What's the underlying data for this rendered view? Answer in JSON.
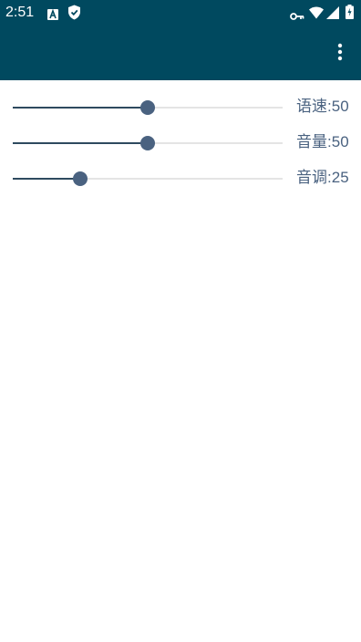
{
  "status_bar": {
    "time": "2:51",
    "icons": [
      "a-notification-icon",
      "shield-icon",
      "key-icon",
      "wifi-icon",
      "signal-icon",
      "battery-charging-icon"
    ]
  },
  "app_bar": {
    "menu_icon": "more-vert-icon",
    "color": "#00495f"
  },
  "sliders": [
    {
      "label": "语速",
      "separator": ":",
      "value": "50",
      "level": 0.5
    },
    {
      "label": "音量",
      "separator": ":",
      "value": "50",
      "level": 0.5
    },
    {
      "label": "音调",
      "separator": ":",
      "value": "25",
      "level": 0.25
    }
  ],
  "colors": {
    "accent": "#4a6280",
    "track": "#e4e4e4",
    "fill": "#2e4a5f"
  }
}
